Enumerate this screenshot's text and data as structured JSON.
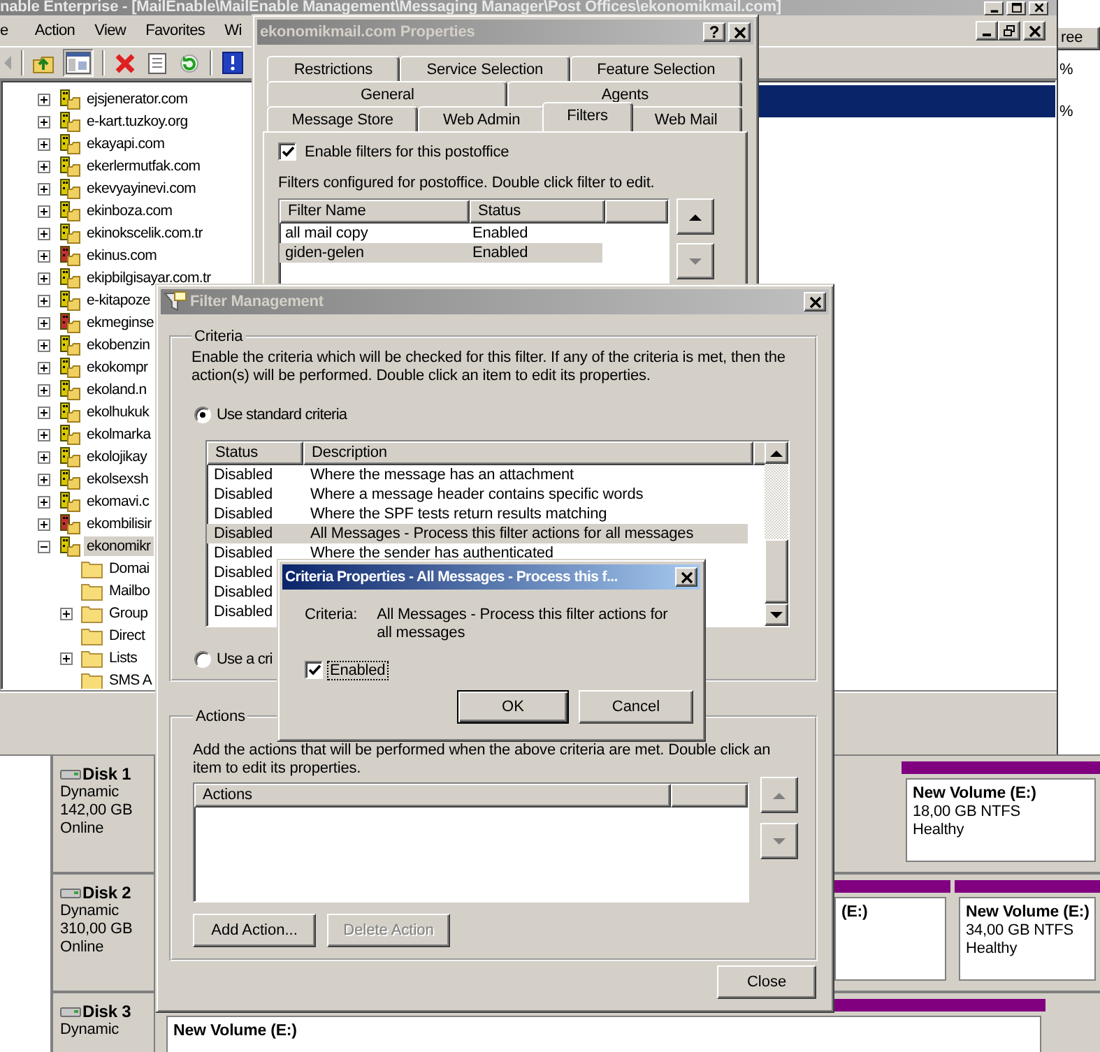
{
  "main_window": {
    "title": "nable Enterprise - [MailEnable\\MailEnable Management\\Messaging Manager\\Post Offices\\ekonomikmail.com]",
    "menu": [
      "e",
      "Action",
      "View",
      "Favorites",
      "Wi"
    ],
    "tree": [
      {
        "label": "ejsjenerator.com",
        "kind": "postoffice",
        "color": "#d8c800",
        "expandable": true,
        "expanded": false,
        "selected": false
      },
      {
        "label": "e-kart.tuzkoy.org",
        "kind": "postoffice",
        "color": "#d8c800",
        "expandable": true,
        "expanded": false,
        "selected": false
      },
      {
        "label": "ekayapi.com",
        "kind": "postoffice",
        "color": "#d8c800",
        "expandable": true,
        "expanded": false,
        "selected": false
      },
      {
        "label": "ekerlermutfak.com",
        "kind": "postoffice",
        "color": "#d8c800",
        "expandable": true,
        "expanded": false,
        "selected": false
      },
      {
        "label": "ekevyayinevi.com",
        "kind": "postoffice",
        "color": "#d8c800",
        "expandable": true,
        "expanded": false,
        "selected": false
      },
      {
        "label": "ekinboza.com",
        "kind": "postoffice",
        "color": "#d8c800",
        "expandable": true,
        "expanded": false,
        "selected": false
      },
      {
        "label": "ekinokscelik.com.tr",
        "kind": "postoffice",
        "color": "#d8c800",
        "expandable": true,
        "expanded": false,
        "selected": false
      },
      {
        "label": "ekinus.com",
        "kind": "postoffice",
        "color": "#c03030",
        "expandable": true,
        "expanded": false,
        "selected": false
      },
      {
        "label": "ekipbilgisayar.com.tr",
        "kind": "postoffice",
        "color": "#d8c800",
        "expandable": true,
        "expanded": false,
        "selected": false
      },
      {
        "label": "e-kitapoze",
        "kind": "postoffice",
        "color": "#d8c800",
        "expandable": true,
        "expanded": false,
        "selected": false
      },
      {
        "label": "ekmeginse",
        "kind": "postoffice",
        "color": "#c03030",
        "expandable": true,
        "expanded": false,
        "selected": false
      },
      {
        "label": "ekobenzin",
        "kind": "postoffice",
        "color": "#d8c800",
        "expandable": true,
        "expanded": false,
        "selected": false
      },
      {
        "label": "ekokompr",
        "kind": "postoffice",
        "color": "#d8c800",
        "expandable": true,
        "expanded": false,
        "selected": false
      },
      {
        "label": "ekoland.n",
        "kind": "postoffice",
        "color": "#d8c800",
        "expandable": true,
        "expanded": false,
        "selected": false
      },
      {
        "label": "ekolhukuk",
        "kind": "postoffice",
        "color": "#d8c800",
        "expandable": true,
        "expanded": false,
        "selected": false
      },
      {
        "label": "ekolmarka",
        "kind": "postoffice",
        "color": "#d8c800",
        "expandable": true,
        "expanded": false,
        "selected": false
      },
      {
        "label": "ekolojikay",
        "kind": "postoffice",
        "color": "#d8c800",
        "expandable": true,
        "expanded": false,
        "selected": false
      },
      {
        "label": "ekolsexsh",
        "kind": "postoffice",
        "color": "#d8c800",
        "expandable": true,
        "expanded": false,
        "selected": false
      },
      {
        "label": "ekomavi.c",
        "kind": "postoffice",
        "color": "#d8c800",
        "expandable": true,
        "expanded": false,
        "selected": false
      },
      {
        "label": "ekombilisir",
        "kind": "postoffice",
        "color": "#c03030",
        "expandable": true,
        "expanded": false,
        "selected": false
      },
      {
        "label": "ekonomikr",
        "kind": "postoffice",
        "color": "#d8c800",
        "expandable": true,
        "expanded": true,
        "selected": true,
        "children": [
          {
            "label": "Domai",
            "kind": "folder",
            "expandable": false,
            "selected": false
          },
          {
            "label": "Mailbo",
            "kind": "folder",
            "expandable": false,
            "selected": false
          },
          {
            "label": "Group",
            "kind": "folder",
            "expandable": true,
            "expanded": false,
            "selected": false
          },
          {
            "label": "Direct",
            "kind": "folder",
            "expandable": false,
            "selected": false
          },
          {
            "label": "Lists",
            "kind": "folder",
            "expandable": true,
            "expanded": false,
            "selected": false
          },
          {
            "label": "SMS A",
            "kind": "folder",
            "expandable": false,
            "selected": false
          }
        ]
      }
    ]
  },
  "background_list": {
    "header": "ree",
    "cells": [
      "%",
      "%"
    ]
  },
  "disk_management": {
    "disks": [
      {
        "name": "Disk 1",
        "type": "Dynamic",
        "size": "142,00 GB",
        "status": "Online",
        "volumes": [
          {
            "name": "New Volume (E:)",
            "size": "18,00 GB NTFS",
            "health": "Healthy"
          }
        ]
      },
      {
        "name": "Disk 2",
        "type": "Dynamic",
        "size": "310,00 GB",
        "status": "Online",
        "volumes": [
          {
            "name": "(E:)"
          },
          {
            "name": "New Volume (E:)",
            "size": "34,00 GB NTFS",
            "health": "Healthy"
          }
        ]
      },
      {
        "name": "Disk 3",
        "type": "Dynamic",
        "volumes": [
          {
            "name": "New Volume (E:)"
          }
        ]
      }
    ]
  },
  "properties_window": {
    "title": "ekonomikmail.com Properties",
    "help_button": "?",
    "tab_rows": [
      [
        {
          "label": "Restrictions",
          "selected": false
        },
        {
          "label": "Service Selection",
          "selected": false
        },
        {
          "label": "Feature Selection",
          "selected": false
        }
      ],
      [
        {
          "label": "General",
          "selected": false
        },
        {
          "label": "Agents",
          "selected": false
        }
      ],
      [
        {
          "label": "Message Store",
          "selected": false
        },
        {
          "label": "Web Admin",
          "selected": false
        },
        {
          "label": "Filters",
          "selected": true
        },
        {
          "label": "Web Mail",
          "selected": false
        }
      ]
    ],
    "enable_filters": {
      "label": "Enable filters for this postoffice",
      "checked": true
    },
    "hint": "Filters configured for postoffice. Double click filter to edit.",
    "filters": {
      "columns": [
        "Filter Name",
        "Status"
      ],
      "rows": [
        {
          "name": "all mail copy",
          "status": "Enabled",
          "selected": false
        },
        {
          "name": "giden-gelen",
          "status": "Enabled",
          "selected": true
        }
      ]
    },
    "move_up": {
      "disabled": false
    },
    "move_down": {
      "disabled": true
    }
  },
  "filter_window": {
    "title": "Filter Management",
    "criteria": {
      "legend": "Criteria",
      "description": "Enable the criteria which will be checked for this filter. If any of the criteria is met, then the action(s) will be performed. Double click an item to edit its properties.",
      "options": [
        {
          "label": "Use standard criteria",
          "selected": true
        },
        {
          "label": "Use a cri",
          "selected": false
        }
      ],
      "columns": [
        "Status",
        "Description"
      ],
      "rows": [
        {
          "status": "Disabled",
          "description": "Where the message has an attachment",
          "selected": false
        },
        {
          "status": "Disabled",
          "description": "Where a message header contains specific words",
          "selected": false
        },
        {
          "status": "Disabled",
          "description": "Where the SPF tests return results matching",
          "selected": false
        },
        {
          "status": "Disabled",
          "description": "All Messages - Process this filter actions for all messages",
          "selected": true
        },
        {
          "status": "Disabled",
          "description": "Where the sender has authenticated",
          "selected": false
        },
        {
          "status": "Disabled",
          "selected": false
        },
        {
          "status": "Disabled",
          "selected": false
        },
        {
          "status": "Disabled",
          "selected": false
        }
      ]
    },
    "actions": {
      "legend": "Actions",
      "description": "Add the actions that will be performed when the above criteria are met. Double click an item to edit its properties.",
      "columns": [
        "Actions"
      ],
      "move_up": {
        "disabled": true
      },
      "move_down": {
        "disabled": true
      },
      "buttons": [
        {
          "label": "Add Action...",
          "disabled": false
        },
        {
          "label": "Delete Action",
          "disabled": true
        }
      ]
    },
    "close": "Close"
  },
  "criteria_dialog": {
    "title": "Criteria Properties - All Messages - Process this f...",
    "label": "Criteria:",
    "value": "All Messages - Process this filter actions for all messages",
    "enabled": {
      "label": "Enabled",
      "checked": true
    },
    "buttons": [
      {
        "label": "OK",
        "default": true
      },
      {
        "label": "Cancel",
        "default": false
      }
    ]
  }
}
